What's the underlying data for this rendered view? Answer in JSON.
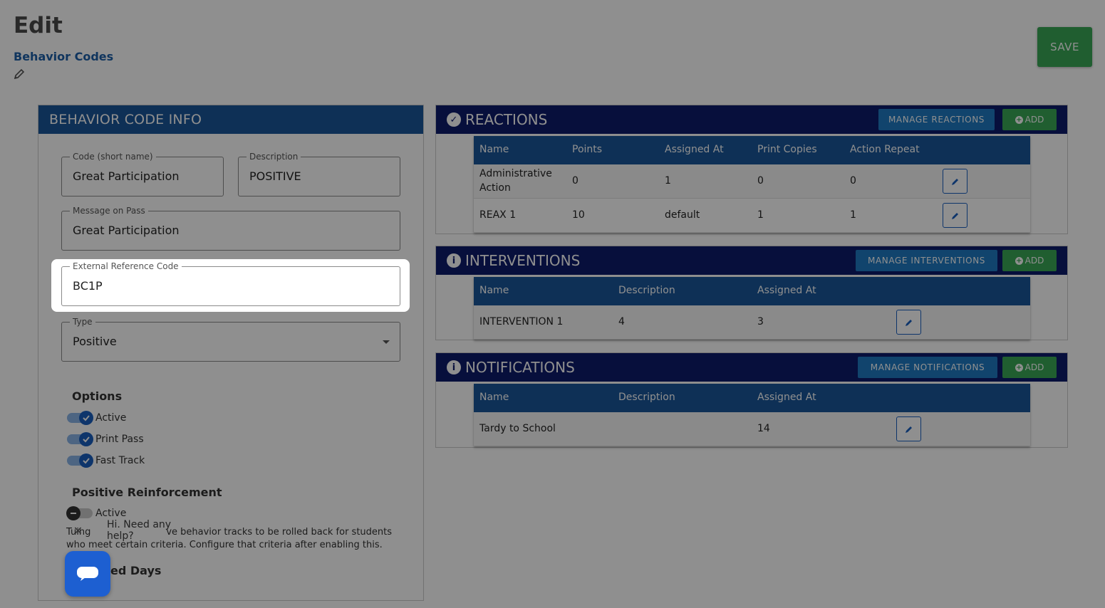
{
  "header": {
    "title": "Edit",
    "breadcrumb": "Behavior Codes",
    "save_label": "SAVE"
  },
  "info_panel": {
    "title": "BEHAVIOR CODE INFO",
    "fields": {
      "code": {
        "label": "Code (short name)",
        "value": "Great Participation"
      },
      "description": {
        "label": "Description",
        "value": "POSITIVE"
      },
      "message": {
        "label": "Message on Pass",
        "value": "Great Participation"
      },
      "external": {
        "label": "External Reference Code",
        "value": "BC1P"
      },
      "type": {
        "label": "Type",
        "value": "Positive"
      }
    },
    "options_label": "Options",
    "options": [
      {
        "label": "Active",
        "checked": true
      },
      {
        "label": "Print Pass",
        "checked": true
      },
      {
        "label": "Fast Track",
        "checked": true
      }
    ],
    "reinforcement_label": "Positive Reinforcement",
    "reinforcement_toggle": "Active",
    "help_text_start": "Tu",
    "help_text_mid": "ing",
    "help_text_rest": "ve behavior tracks to be rolled back for students who meet certain criteria. Configure that criteria after enabling this.",
    "days_label": "ed Days"
  },
  "reactions": {
    "title": "REACTIONS",
    "manage_label": "MANAGE REACTIONS",
    "add_label": "ADD",
    "columns": [
      "Name",
      "Points",
      "Assigned At",
      "Print Copies",
      "Action Repeat"
    ],
    "rows": [
      {
        "name": "Administrative",
        "name2": "Action",
        "points": "0",
        "assigned": "1",
        "copies": "0",
        "repeat": "0"
      },
      {
        "name": "REAX 1",
        "name2": "",
        "points": "10",
        "assigned": "default",
        "copies": "1",
        "repeat": "1"
      }
    ]
  },
  "interventions": {
    "title": "INTERVENTIONS",
    "manage_label": "MANAGE INTERVENTIONS",
    "add_label": "ADD",
    "columns": [
      "Name",
      "Description",
      "Assigned At"
    ],
    "rows": [
      {
        "name": "INTERVENTION 1",
        "description": "4",
        "assigned": "3"
      }
    ]
  },
  "notifications": {
    "title": "NOTIFICATIONS",
    "manage_label": "MANAGE NOTIFICATIONS",
    "add_label": "ADD",
    "columns": [
      "Name",
      "Description",
      "Assigned At"
    ],
    "rows": [
      {
        "name": "Tardy to School",
        "description": "",
        "assigned": "14"
      }
    ]
  },
  "chat": {
    "message": "Hi. Need any help?",
    "close": "✕"
  },
  "colors": {
    "primary_blue": "#1a5799",
    "navy_header": "#0e1b6b",
    "green": "#3aa856"
  }
}
